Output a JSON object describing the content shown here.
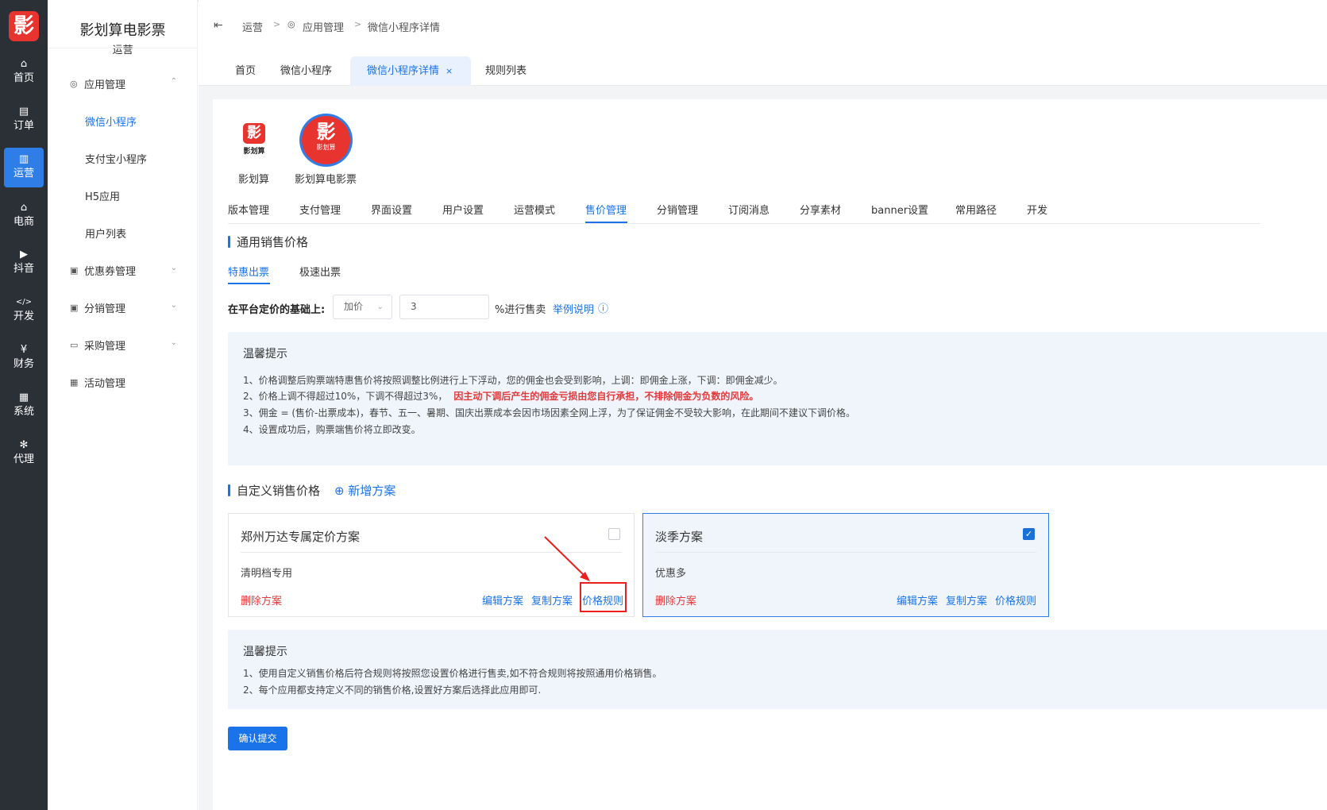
{
  "rail": {
    "logo_glyph": "影",
    "items": [
      {
        "icon": "home-icon",
        "glyph": "⌂",
        "label": "首页"
      },
      {
        "icon": "order-icon",
        "glyph": "▤",
        "label": "订单"
      },
      {
        "icon": "chart-icon",
        "glyph": "▥",
        "label": "运营",
        "active": true
      },
      {
        "icon": "store-icon",
        "glyph": "⌂",
        "label": "电商"
      },
      {
        "icon": "video-icon",
        "glyph": "▶",
        "label": "抖音"
      },
      {
        "icon": "code-icon",
        "glyph": "</>",
        "label": "开发"
      },
      {
        "icon": "yen-icon",
        "glyph": "¥",
        "label": "财务"
      },
      {
        "icon": "grid-icon",
        "glyph": "▦",
        "label": "系统"
      },
      {
        "icon": "agent-icon",
        "glyph": "✻",
        "label": "代理"
      }
    ]
  },
  "menu": {
    "title": "影划算电影票",
    "subtitle": "运营",
    "groups": [
      {
        "label": "应用管理",
        "chev": "⌃",
        "subs": [
          "微信小程序",
          "支付宝小程序",
          "H5应用",
          "用户列表"
        ]
      },
      {
        "label": "优惠券管理",
        "chev": "⌄"
      },
      {
        "label": "分销管理",
        "chev": "⌄"
      },
      {
        "label": "采购管理",
        "chev": "⌄"
      },
      {
        "label": "活动管理"
      }
    ]
  },
  "breadcrumb": {
    "collapse": "⇤",
    "items": [
      "运营",
      "应用管理",
      "微信小程序详情"
    ],
    "sep": ">"
  },
  "page_tabs": [
    "首页",
    "微信小程序",
    "微信小程序详情",
    "规则列表"
  ],
  "page_tab_close": "×",
  "apps": [
    {
      "name": "影划算",
      "logo_text": "影",
      "logo_sub": "影划算"
    },
    {
      "name": "影划算电影票",
      "logo_text": "影",
      "logo_sub": "影划算"
    }
  ],
  "sub_tabs": [
    "版本管理",
    "支付管理",
    "界面设置",
    "用户设置",
    "运营模式",
    "售价管理",
    "分销管理",
    "订阅消息",
    "分享素材",
    "banner设置",
    "常用路径",
    "开发"
  ],
  "general": {
    "title": "通用销售价格",
    "ticket_tabs": [
      "特惠出票",
      "极速出票"
    ],
    "label": "在平台定价的基础上:",
    "select_value": "加价",
    "caret": "⌄",
    "input_value": "3",
    "suffix": "%进行售卖",
    "example_link": "举例说明",
    "info_icon": "ⓘ"
  },
  "tip1": {
    "title": "温馨提示",
    "lines": [
      "1、价格调整后购票端特惠售价将按照调整比例进行上下浮动，您的佣金也会受到影响，上调：即佣金上涨，下调：即佣金减少。",
      "2、价格上调不得超过10%，下调不得超过3%，",
      "3、佣金 = (售价-出票成本)，春节、五一、暑期、国庆出票成本会因市场因素全网上浮，为了保证佣金不受较大影响，在此期间不建议下调价格。",
      "4、设置成功后，购票端售价将立即改变。"
    ],
    "red": "因主动下调后产生的佣金亏损由您自行承担，不排除佣金为负数的风险。"
  },
  "custom": {
    "title": "自定义销售价格",
    "add_icon": "⊕",
    "add": "新增方案"
  },
  "cards": [
    {
      "title": "郑州万达专属定价方案",
      "desc": "清明档专用",
      "del": "删除方案",
      "edit": "编辑方案",
      "copy": "复制方案",
      "rule": "价格规则",
      "checked": false
    },
    {
      "title": "淡季方案",
      "desc": "优惠多",
      "del": "删除方案",
      "edit": "编辑方案",
      "copy": "复制方案",
      "rule": "价格规则",
      "checked": true,
      "check_glyph": "✓"
    }
  ],
  "tip2": {
    "title": "温馨提示",
    "lines": [
      "1、使用自定义销售价格后符合规则将按照您设置价格进行售卖,如不符合规则将按照通用价格销售。",
      "2、每个应用都支持定义不同的销售价格,设置好方案后选择此应用即可."
    ]
  },
  "submit": "确认提交",
  "colors": {
    "accent": "#1a73e8",
    "danger": "#e23a3a",
    "rail": "#2b2f36",
    "annotation": "#e8201e"
  }
}
